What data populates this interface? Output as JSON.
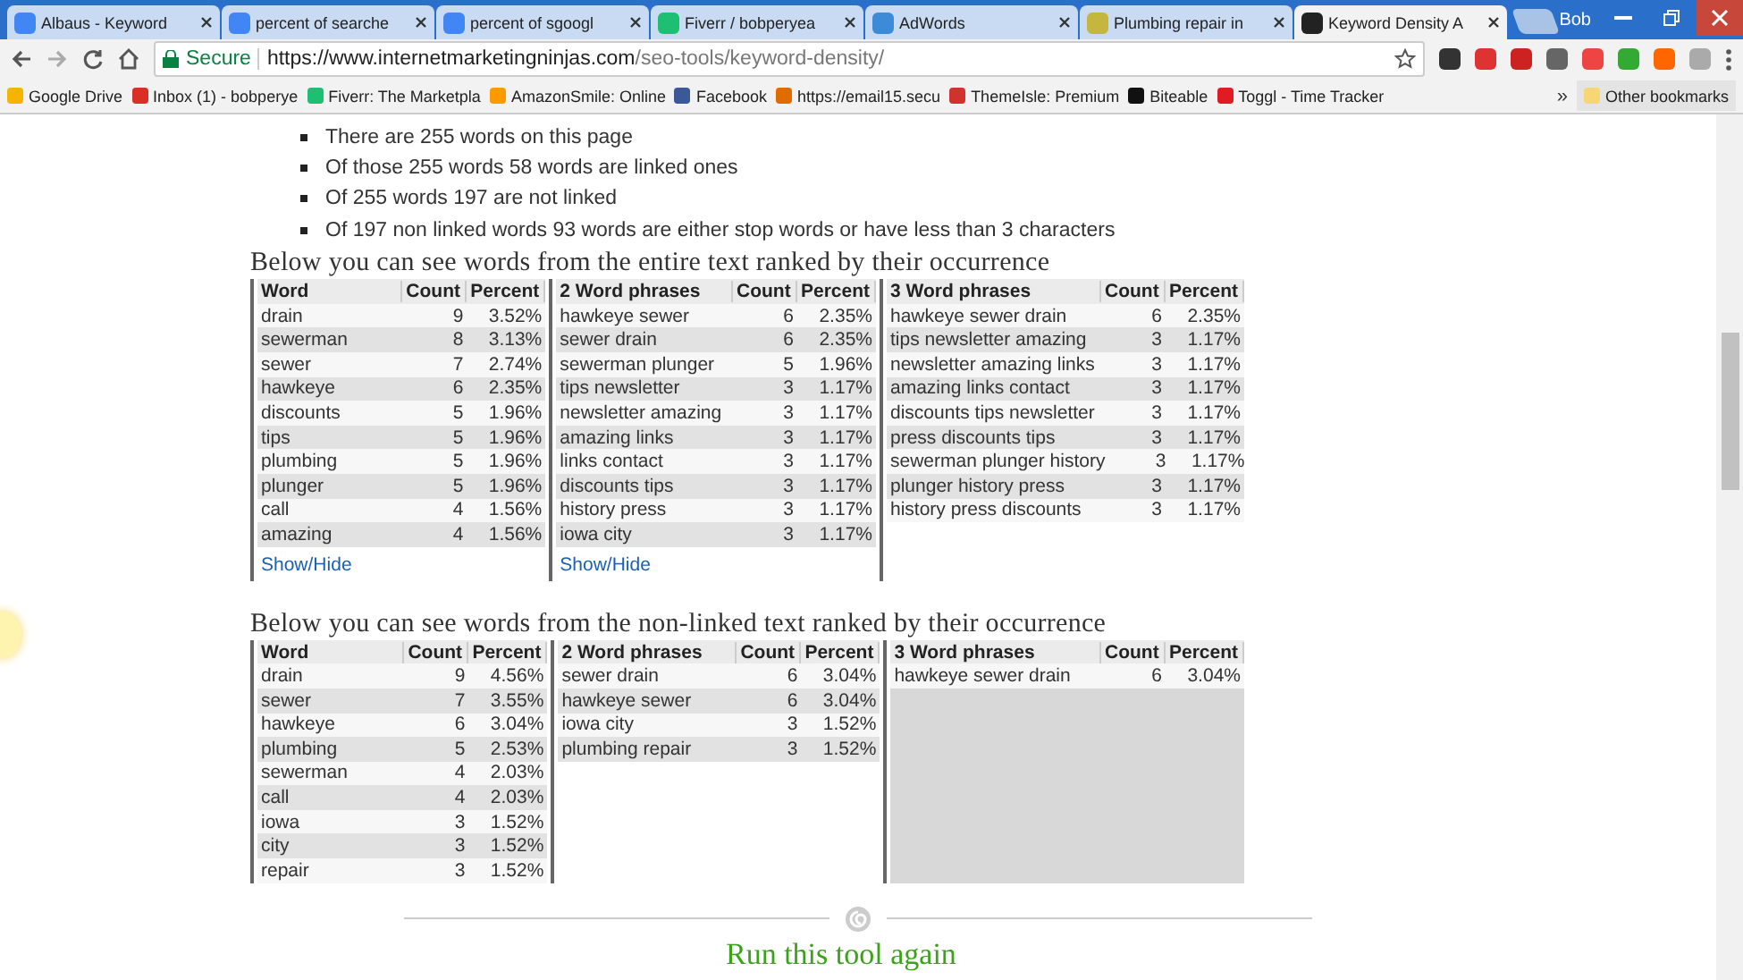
{
  "browser": {
    "tabs": [
      {
        "title": "Albaus - Keyword",
        "selected": false
      },
      {
        "title": "percent of searche",
        "selected": false
      },
      {
        "title": "percent of sgoogl",
        "selected": false
      },
      {
        "title": "Fiverr / bobperyea",
        "selected": false
      },
      {
        "title": "AdWords",
        "selected": false
      },
      {
        "title": "Plumbing repair in",
        "selected": false
      },
      {
        "title": "Keyword Density A",
        "selected": true
      }
    ],
    "profile": "Bob",
    "secure_label": "Secure",
    "url_host": "https://www.internetmarketingninjas.com",
    "url_path": "/seo-tools/keyword-density/",
    "bookmarks": [
      {
        "label": "Google Drive",
        "color": "#f4b400"
      },
      {
        "label": "Inbox (1) - bobperye",
        "color": "#d93025"
      },
      {
        "label": "Fiverr: The Marketpla",
        "color": "#1dbf73"
      },
      {
        "label": "AmazonSmile: Online",
        "color": "#ff9900"
      },
      {
        "label": "Facebook",
        "color": "#3b5998"
      },
      {
        "label": "https://email15.secu",
        "color": "#e06c00"
      },
      {
        "label": "ThemeIsle: Premium",
        "color": "#d2322d"
      },
      {
        "label": "Biteable",
        "color": "#111111"
      },
      {
        "label": "Toggl - Time Tracker",
        "color": "#e01b22"
      }
    ],
    "more": "»",
    "other_bookmarks": "Other bookmarks"
  },
  "stats": [
    "There are 255 words on this page",
    "Of those 255 words 58 words are linked ones",
    "Of 255 words 197 are not linked",
    "Of 197 non linked words 93 words are either stop words or have less than 3 characters"
  ],
  "sections": [
    {
      "heading": "Below you can see words from the entire text ranked by their occurrence",
      "tables": [
        {
          "columns": [
            "Word",
            "Count",
            "Percent"
          ],
          "rows": [
            [
              "drain",
              "9",
              "3.52%"
            ],
            [
              "sewerman",
              "8",
              "3.13%"
            ],
            [
              "sewer",
              "7",
              "2.74%"
            ],
            [
              "hawkeye",
              "6",
              "2.35%"
            ],
            [
              "discounts",
              "5",
              "1.96%"
            ],
            [
              "tips",
              "5",
              "1.96%"
            ],
            [
              "plumbing",
              "5",
              "1.96%"
            ],
            [
              "plunger",
              "5",
              "1.96%"
            ],
            [
              "call",
              "4",
              "1.56%"
            ],
            [
              "amazing",
              "4",
              "1.56%"
            ]
          ],
          "show_hide": "Show/Hide"
        },
        {
          "columns": [
            "2 Word phrases",
            "Count",
            "Percent"
          ],
          "rows": [
            [
              "hawkeye sewer",
              "6",
              "2.35%"
            ],
            [
              "sewer drain",
              "6",
              "2.35%"
            ],
            [
              "sewerman plunger",
              "5",
              "1.96%"
            ],
            [
              "tips newsletter",
              "3",
              "1.17%"
            ],
            [
              "newsletter amazing",
              "3",
              "1.17%"
            ],
            [
              "amazing links",
              "3",
              "1.17%"
            ],
            [
              "links contact",
              "3",
              "1.17%"
            ],
            [
              "discounts tips",
              "3",
              "1.17%"
            ],
            [
              "history press",
              "3",
              "1.17%"
            ],
            [
              "iowa city",
              "3",
              "1.17%"
            ]
          ],
          "show_hide": "Show/Hide"
        },
        {
          "columns": [
            "3 Word phrases",
            "Count",
            "Percent"
          ],
          "rows": [
            [
              "hawkeye sewer drain",
              "6",
              "2.35%"
            ],
            [
              "tips newsletter amazing",
              "3",
              "1.17%"
            ],
            [
              "newsletter amazing links",
              "3",
              "1.17%"
            ],
            [
              "amazing links contact",
              "3",
              "1.17%"
            ],
            [
              "discounts tips newsletter",
              "3",
              "1.17%"
            ],
            [
              "press discounts tips",
              "3",
              "1.17%"
            ],
            [
              "sewerman plunger history",
              "3",
              "1.17%"
            ],
            [
              "plunger history press",
              "3",
              "1.17%"
            ],
            [
              "history press discounts",
              "3",
              "1.17%"
            ]
          ]
        }
      ]
    },
    {
      "heading": "Below you can see words from the non-linked text ranked by their occurrence",
      "tables": [
        {
          "columns": [
            "Word",
            "Count",
            "Percent"
          ],
          "rows": [
            [
              "drain",
              "9",
              "4.56%"
            ],
            [
              "sewer",
              "7",
              "3.55%"
            ],
            [
              "hawkeye",
              "6",
              "3.04%"
            ],
            [
              "plumbing",
              "5",
              "2.53%"
            ],
            [
              "sewerman",
              "4",
              "2.03%"
            ],
            [
              "call",
              "4",
              "2.03%"
            ],
            [
              "iowa",
              "3",
              "1.52%"
            ],
            [
              "city",
              "3",
              "1.52%"
            ],
            [
              "repair",
              "3",
              "1.52%"
            ]
          ]
        },
        {
          "columns": [
            "2 Word phrases",
            "Count",
            "Percent"
          ],
          "rows": [
            [
              "sewer drain",
              "6",
              "3.04%"
            ],
            [
              "hawkeye sewer",
              "6",
              "3.04%"
            ],
            [
              "iowa city",
              "3",
              "1.52%"
            ],
            [
              "plumbing repair",
              "3",
              "1.52%"
            ]
          ]
        },
        {
          "columns": [
            "3 Word phrases",
            "Count",
            "Percent"
          ],
          "rows": [
            [
              "hawkeye sewer drain",
              "6",
              "3.04%"
            ]
          ]
        }
      ]
    }
  ],
  "run_again": "Run this tool again"
}
